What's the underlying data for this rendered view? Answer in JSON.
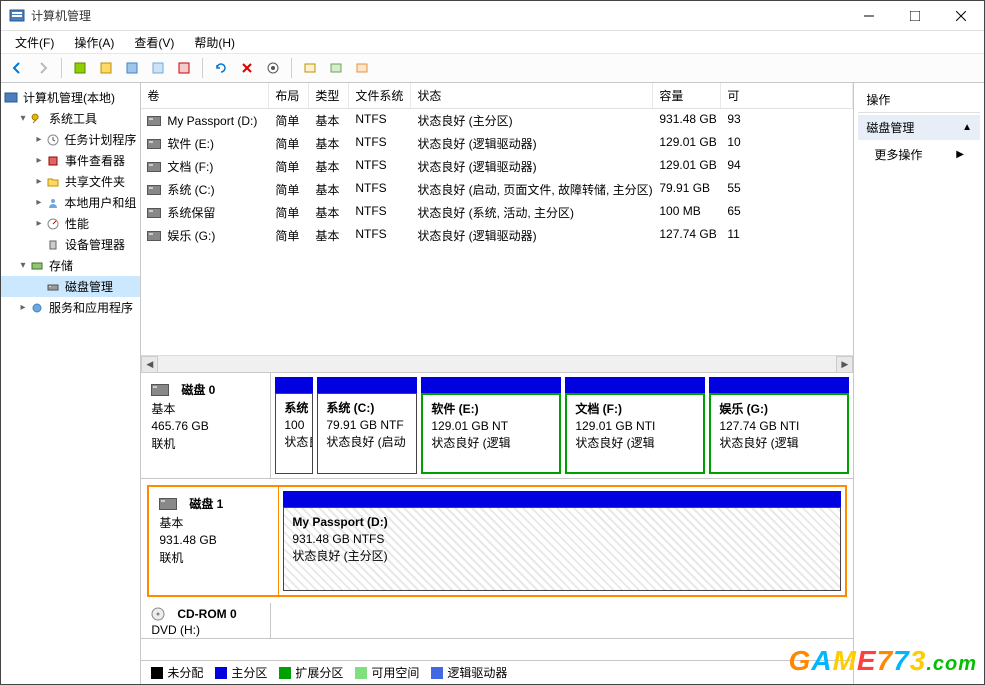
{
  "window": {
    "title": "计算机管理"
  },
  "menus": [
    "文件(F)",
    "操作(A)",
    "查看(V)",
    "帮助(H)"
  ],
  "tree": {
    "root": "计算机管理(本地)",
    "g1": "系统工具",
    "g1items": [
      "任务计划程序",
      "事件查看器",
      "共享文件夹",
      "本地用户和组",
      "性能",
      "设备管理器"
    ],
    "g2": "存储",
    "g2a": "磁盘管理",
    "g3": "服务和应用程序"
  },
  "cols": {
    "vol": "卷",
    "layout": "布局",
    "type": "类型",
    "fs": "文件系统",
    "status": "状态",
    "cap": "容量",
    "free": "可"
  },
  "volumes": [
    {
      "name": "My Passport (D:)",
      "layout": "简单",
      "type": "基本",
      "fs": "NTFS",
      "status": "状态良好 (主分区)",
      "cap": "931.48 GB",
      "free": "93"
    },
    {
      "name": "软件 (E:)",
      "layout": "简单",
      "type": "基本",
      "fs": "NTFS",
      "status": "状态良好 (逻辑驱动器)",
      "cap": "129.01 GB",
      "free": "10"
    },
    {
      "name": "文档 (F:)",
      "layout": "简单",
      "type": "基本",
      "fs": "NTFS",
      "status": "状态良好 (逻辑驱动器)",
      "cap": "129.01 GB",
      "free": "94"
    },
    {
      "name": "系统 (C:)",
      "layout": "简单",
      "type": "基本",
      "fs": "NTFS",
      "status": "状态良好 (启动, 页面文件, 故障转储, 主分区)",
      "cap": "79.91 GB",
      "free": "55"
    },
    {
      "name": "系统保留",
      "layout": "简单",
      "type": "基本",
      "fs": "NTFS",
      "status": "状态良好 (系统, 活动, 主分区)",
      "cap": "100 MB",
      "free": "65"
    },
    {
      "name": "娱乐 (G:)",
      "layout": "简单",
      "type": "基本",
      "fs": "NTFS",
      "status": "状态良好 (逻辑驱动器)",
      "cap": "127.74 GB",
      "free": "11"
    }
  ],
  "disks": {
    "d0": {
      "name": "磁盘 0",
      "type": "基本",
      "size": "465.76 GB",
      "stat": "联机",
      "parts": [
        {
          "name": "系统",
          "size": "100",
          "status": "状态良好 ("
        },
        {
          "name": "系统  (C:)",
          "size": "79.91 GB NTF",
          "status": "状态良好 (启动"
        },
        {
          "name": "软件  (E:)",
          "size": "129.01 GB NT",
          "status": "状态良好 (逻辑"
        },
        {
          "name": "文档  (F:)",
          "size": "129.01 GB NTI",
          "status": "状态良好 (逻辑"
        },
        {
          "name": "娱乐  (G:)",
          "size": "127.74 GB NTI",
          "status": "状态良好 (逻辑"
        }
      ]
    },
    "d1": {
      "name": "磁盘 1",
      "type": "基本",
      "size": "931.48 GB",
      "stat": "联机",
      "part": {
        "name": "My Passport  (D:)",
        "size": "931.48 GB NTFS",
        "status": "状态良好 (主分区)"
      }
    },
    "cd": {
      "name": "CD-ROM 0",
      "sub": "DVD (H:)"
    }
  },
  "legend": {
    "un": "未分配",
    "pri": "主分区",
    "ext": "扩展分区",
    "free": "可用空间",
    "log": "逻辑驱动器"
  },
  "actions": {
    "title": "操作",
    "group": "磁盘管理",
    "more": "更多操作"
  },
  "colors": {
    "primary": "#0000e0",
    "extend": "#00a000",
    "free": "#80e080",
    "log": "#4169e1",
    "orange": "#ff8c00"
  },
  "watermark": "GAME773.com"
}
